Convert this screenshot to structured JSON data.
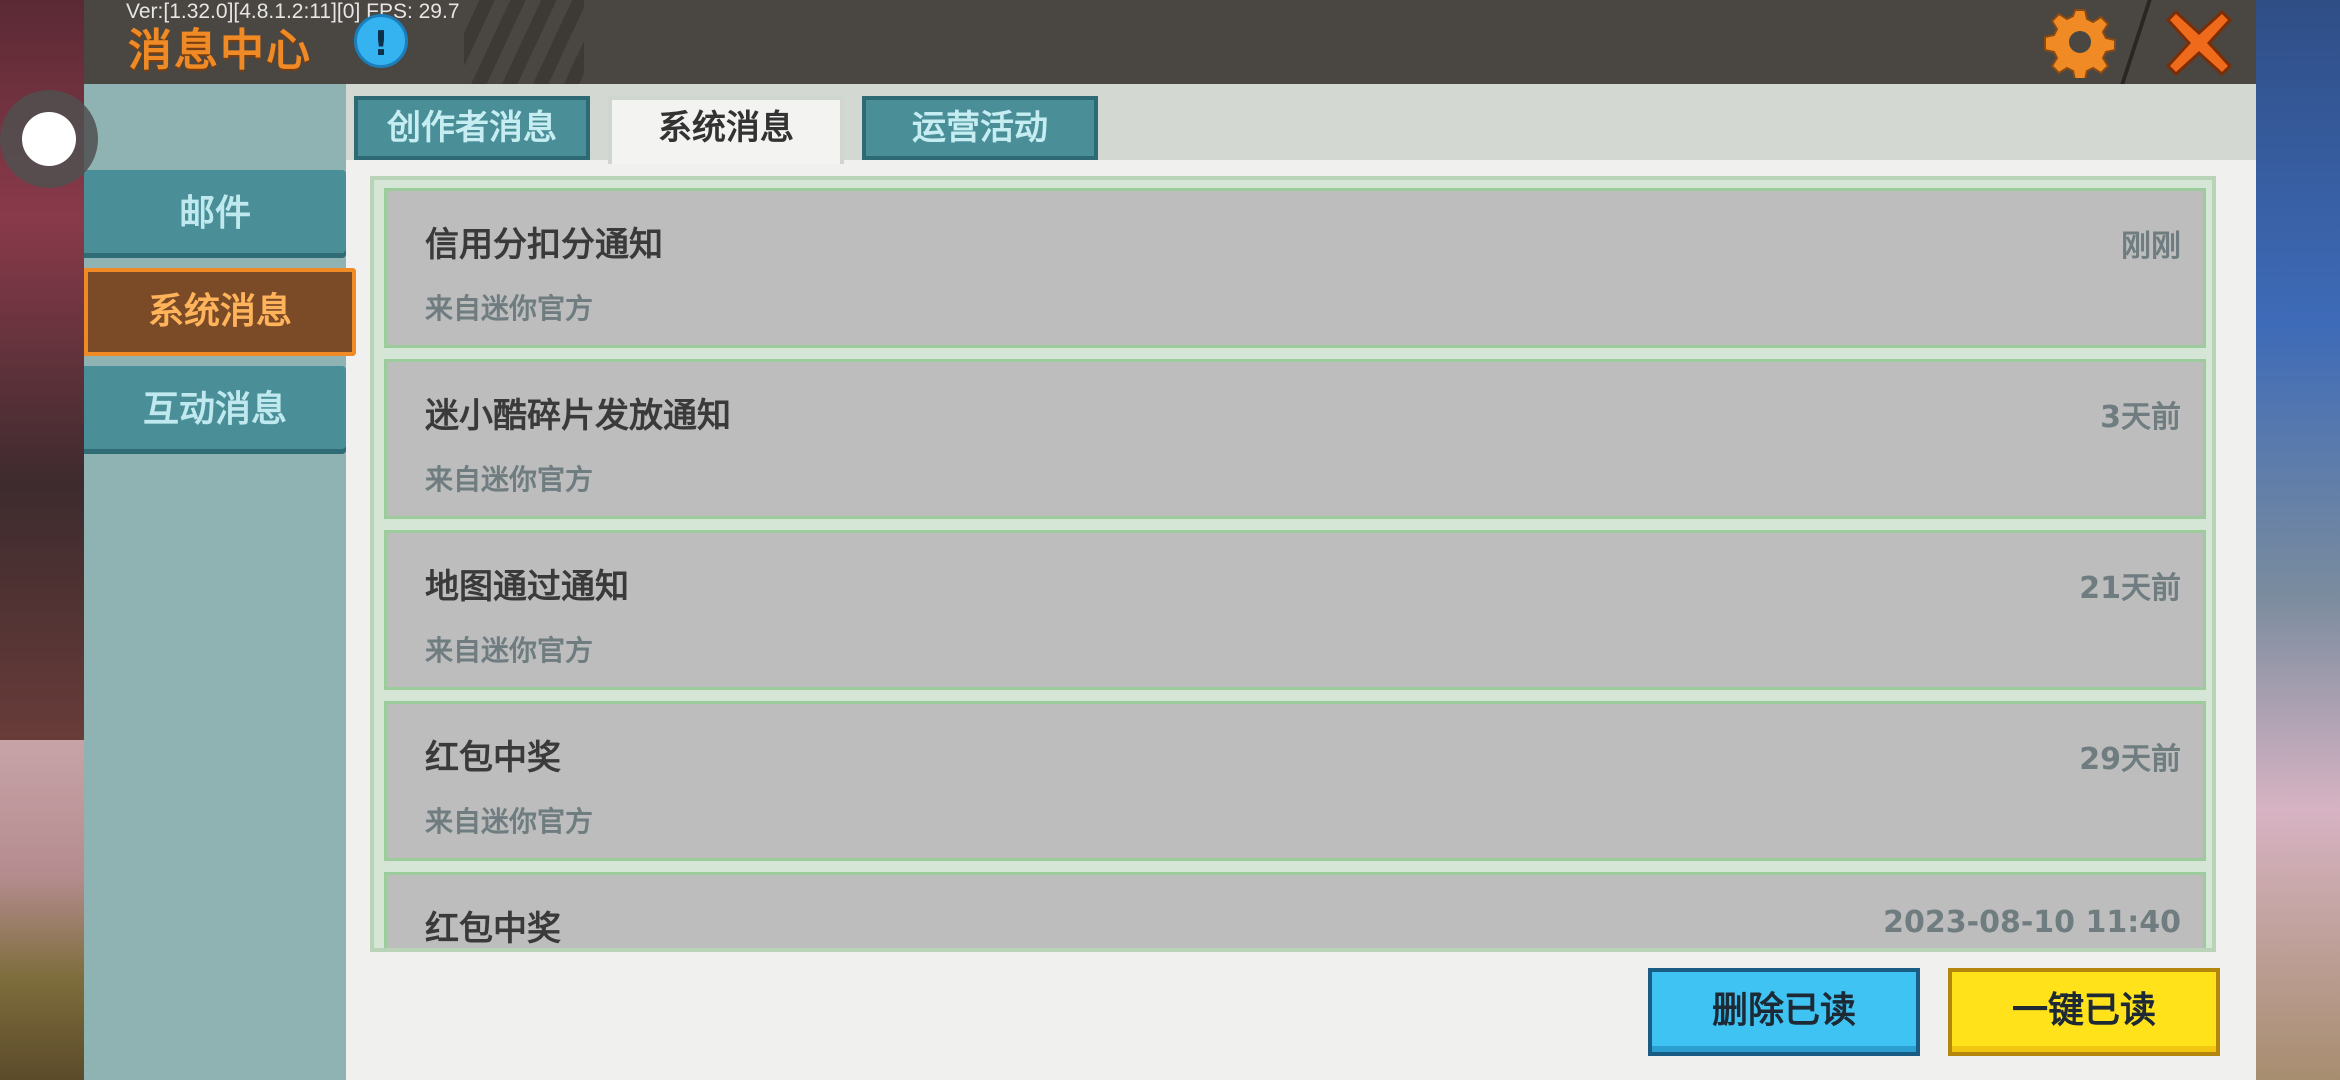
{
  "header": {
    "title": "消息中心",
    "version": "Ver:[1.32.0][4.8.1.2:11][0] FPS: 29.7"
  },
  "sidebar": {
    "items": [
      {
        "label": "邮件"
      },
      {
        "label": "系统消息"
      },
      {
        "label": "互动消息"
      }
    ],
    "active_index": 1
  },
  "tabs": {
    "items": [
      {
        "label": "创作者消息"
      },
      {
        "label": "系统消息"
      },
      {
        "label": "运营活动"
      }
    ],
    "active_index": 1
  },
  "messages": [
    {
      "title": "信用分扣分通知",
      "from": "来自迷你官方",
      "time": "刚刚"
    },
    {
      "title": "迷小酷碎片发放通知",
      "from": "来自迷你官方",
      "time": "3天前"
    },
    {
      "title": "地图通过通知",
      "from": "来自迷你官方",
      "time": "21天前"
    },
    {
      "title": "红包中奖",
      "from": "来自迷你官方",
      "time": "29天前"
    },
    {
      "title": "红包中奖",
      "from": "",
      "time": "2023-08-10 11:40"
    }
  ],
  "buttons": {
    "delete_read": "删除已读",
    "mark_all_read": "一键已读"
  },
  "colors": {
    "accent_orange": "#f08a24",
    "teal": "#4a8e98",
    "delete_blue": "#3fc3f3",
    "read_yellow": "#ffe21a"
  },
  "icons": [
    "info-icon",
    "gear-icon",
    "close-icon"
  ]
}
